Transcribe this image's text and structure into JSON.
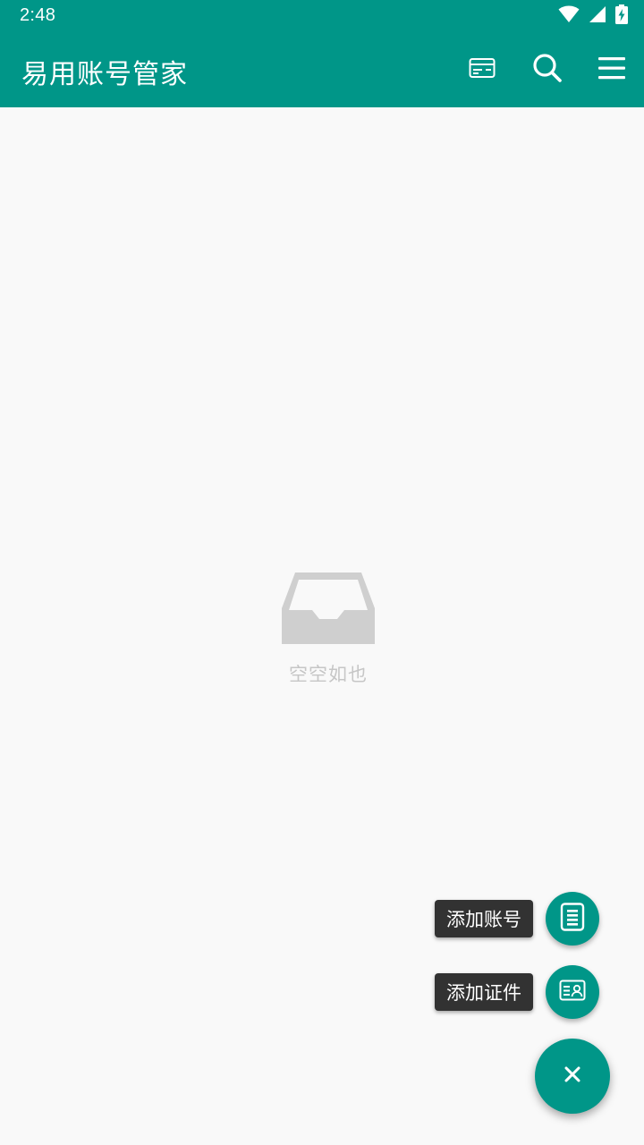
{
  "status_bar": {
    "time": "2:48",
    "icons": [
      "wifi-icon",
      "cell-signal-icon",
      "battery-charging-icon"
    ]
  },
  "app_bar": {
    "title": "易用账号管家",
    "actions": [
      "card-icon",
      "search-icon",
      "menu-icon"
    ]
  },
  "empty_state": {
    "icon": "inbox-tray-icon",
    "text": "空空如也"
  },
  "fab_menu": {
    "items": [
      {
        "label": "添加账号",
        "icon": "document-list-icon"
      },
      {
        "label": "添加证件",
        "icon": "id-card-icon"
      }
    ],
    "main_icon": "close-icon"
  },
  "colors": {
    "primary": "#009688",
    "background": "#f9f9f9",
    "label_bg": "#323232",
    "empty_gray": "#cfcfcf"
  }
}
